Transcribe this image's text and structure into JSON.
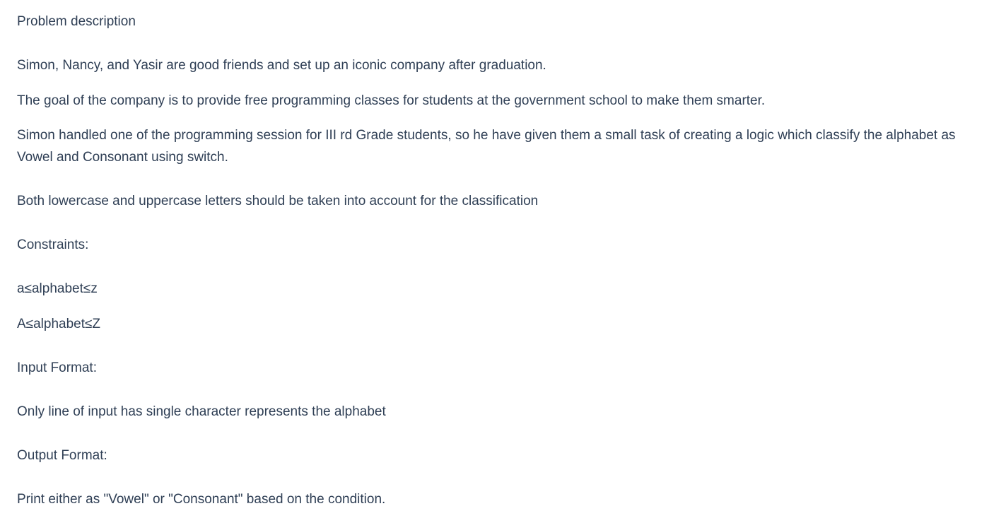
{
  "problem": {
    "heading": "Problem description",
    "paragraphs": [
      "Simon, Nancy, and Yasir are good friends and set up an iconic company after graduation.",
      "The goal of the company is to provide free programming classes for students at the government school to make them smarter.",
      "Simon handled one of the programming session for III rd Grade students, so he have given them a small task of creating a logic which classify the alphabet as Vowel and Consonant using switch.",
      "Both lowercase and uppercase letters should be taken into account for the classification"
    ],
    "constraints_label": "Constraints:",
    "constraints": [
      "a≤alphabet≤z",
      "A≤alphabet≤Z"
    ],
    "input_format_label": "Input Format:",
    "input_format_text": "Only line of input has single character represents the alphabet",
    "output_format_label": "Output Format:",
    "output_format_text": "Print either as \"Vowel\" or \"Consonant\" based on the condition."
  }
}
